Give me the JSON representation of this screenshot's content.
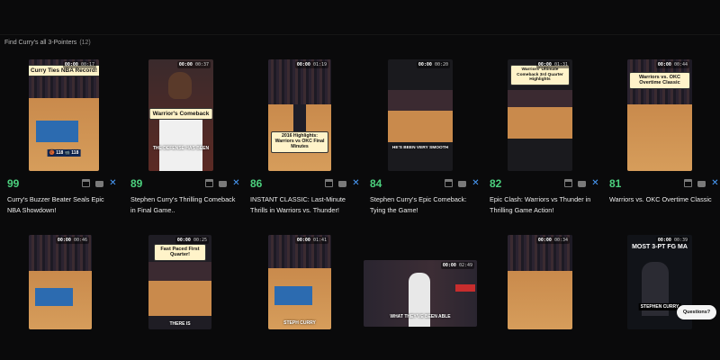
{
  "header": {
    "title": "Find Curry's all 3-Pointers",
    "count": "(12)"
  },
  "icon_names": [
    "calendar-icon",
    "bag-icon",
    "close-icon"
  ],
  "colors": {
    "score": "#4cd17e",
    "close": "#4a9eff",
    "background": "#0a0a0b"
  },
  "cards": [
    {
      "score": "99",
      "title": "Curry's Buzzer Beater Seals Epic NBA Showdown!",
      "time_current": "00:00",
      "time_total": "00:17",
      "caption": "Curry Ties NBA Record!",
      "overlay": "🏀 118 📹 118"
    },
    {
      "score": "89",
      "title": "Stephen Curry's Thrilling Comeback in Final Game..",
      "time_current": "00:00",
      "time_total": "00:37",
      "caption": "Warrior's Comeback",
      "overlay": "THE DEFENSE HAS BEEN"
    },
    {
      "score": "86",
      "title": "INSTANT CLASSIC: Last-Minute Thrills in Warriors vs. Thunder!",
      "time_current": "00:00",
      "time_total": "01:19",
      "caption": "2016 Highlights: Warriors vs OKC Final Minutes",
      "overlay": ""
    },
    {
      "score": "84",
      "title": "Stephen Curry's Epic Comeback: Tying the Game!",
      "time_current": "00:00",
      "time_total": "00:20",
      "caption": "",
      "overlay": "HE'S BEEN VERY SMOOTH"
    },
    {
      "score": "82",
      "title": "Epic Clash: Warriors vs Thunder in Thrilling Game Action!",
      "time_current": "00:00",
      "time_total": "01:31",
      "caption": "Warriors' Ultimate Comeback 3rd Quarter Highlights",
      "overlay": ""
    },
    {
      "score": "81",
      "title": "Warriors vs. OKC Overtime Classic",
      "time_current": "00:00",
      "time_total": "00:44",
      "caption": "Warriors vs. OKC Overtime Classic",
      "overlay": ""
    },
    {
      "time_current": "00:00",
      "time_total": "00:46",
      "caption": "",
      "overlay": ""
    },
    {
      "time_current": "00:00",
      "time_total": "00:25",
      "caption": "Fast Paced First Quarter!",
      "overlay": "THERE IS"
    },
    {
      "time_current": "00:00",
      "time_total": "01:41",
      "caption": "",
      "overlay": "STEPH CURRY"
    },
    {
      "time_current": "00:00",
      "time_total": "02:49",
      "caption": "",
      "overlay": "WHAT THEY'VE BEEN ABLE"
    },
    {
      "time_current": "00:00",
      "time_total": "00:34",
      "caption": "",
      "overlay": ""
    },
    {
      "time_current": "00:00",
      "time_total": "00:39",
      "caption": "MOST 3-PT FG MA",
      "overlay": "STEPHEN CURRY"
    }
  ],
  "questions_label": "Questions?"
}
